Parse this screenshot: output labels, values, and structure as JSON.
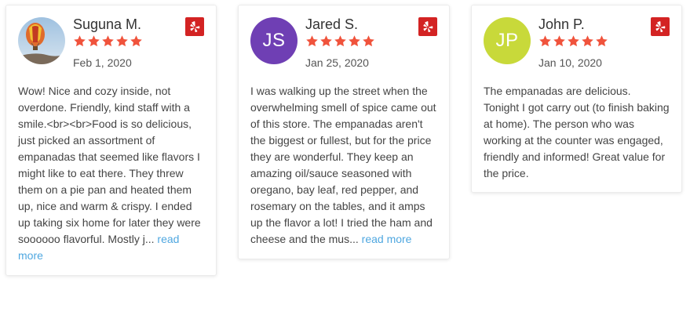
{
  "theme": {
    "star_color": "#f0533c",
    "yelp_red": "#d32323",
    "link_color": "#4fa7e0"
  },
  "reviews": [
    {
      "name": "Suguna M.",
      "rating": 5,
      "date": "Feb 1, 2020",
      "avatar": {
        "type": "photo",
        "icon": "hot-air-balloon-photo"
      },
      "text": "Wow! Nice and cozy inside, not overdone. Friendly, kind staff with a smile.<br><br>Food is so delicious, just picked an assortment of empanadas that seemed like flavors I might like to eat there. They threw them on a pie pan and heated them up, nice and warm & crispy.  I ended up taking six home for later they were soooooo flavorful. Mostly j...",
      "read_more": "read more",
      "source_icon": "yelp-icon"
    },
    {
      "name": "Jared S.",
      "rating": 5,
      "date": "Jan 25, 2020",
      "avatar": {
        "type": "initials",
        "initials": "JS",
        "color": "#6f3fb4"
      },
      "text": "I was walking up the street when the overwhelming smell of spice came out of this store.  The empanadas aren't the biggest or fullest, but for the  price they are wonderful. They keep an amazing oil/sauce seasoned with oregano, bay leaf, red pepper, and rosemary on the tables, and it amps up the flavor a lot! I tried the ham and cheese  and the mus...",
      "read_more": "read more",
      "source_icon": "yelp-icon"
    },
    {
      "name": "John P.",
      "rating": 5,
      "date": "Jan 10, 2020",
      "avatar": {
        "type": "initials",
        "initials": "JP",
        "color": "#c8d93a"
      },
      "text": "The empanadas are delicious.\n Tonight I got carry out (to finish baking at home).  The person who was working at the counter was engaged, friendly and informed!  Great value for the price.",
      "read_more": "",
      "source_icon": "yelp-icon"
    }
  ]
}
